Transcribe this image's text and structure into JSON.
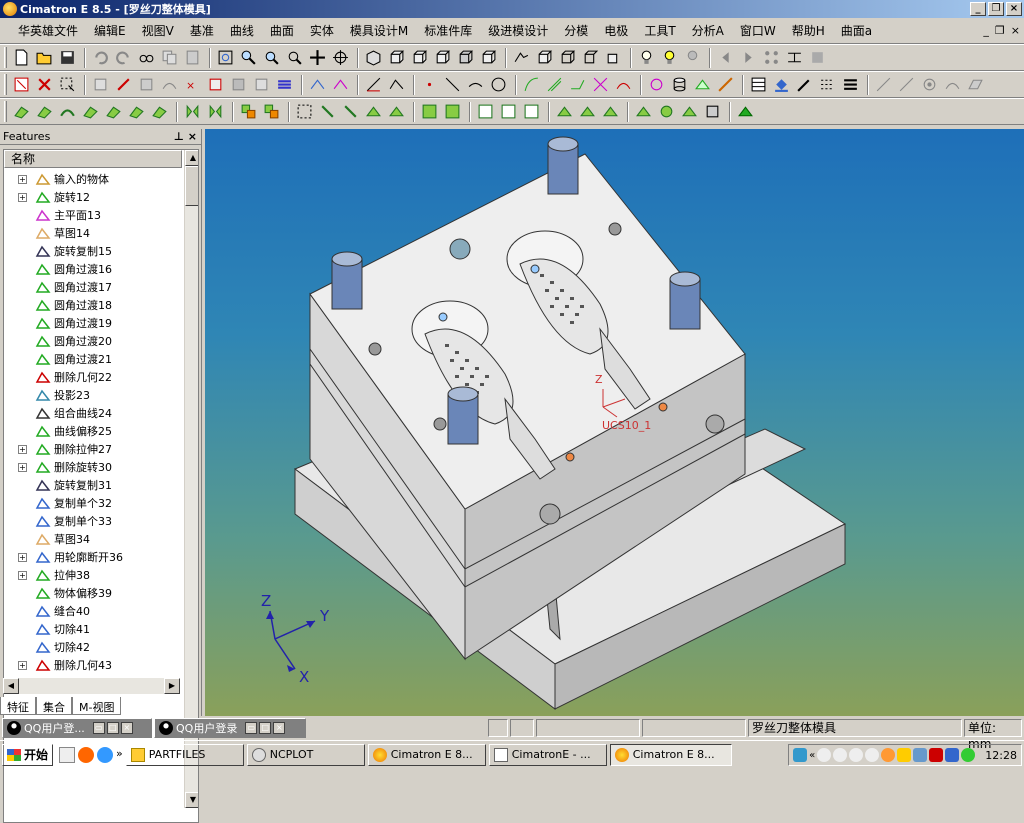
{
  "window": {
    "title": "Cimatron E 8.5 - [罗丝刀整体模具]"
  },
  "menu": {
    "items": [
      "华英雄文件",
      "编辑E",
      "视图V",
      "基准",
      "曲线",
      "曲面",
      "实体",
      "模具设计M",
      "标准件库",
      "级进模设计",
      "分模",
      "电极",
      "工具T",
      "分析A",
      "窗口W",
      "帮助H",
      "曲面a"
    ]
  },
  "features_panel": {
    "title": "Features",
    "column_header": "名称",
    "items": [
      {
        "label": "输入的物体",
        "expandable": true,
        "icon": "import-icon"
      },
      {
        "label": "旋转12",
        "expandable": true,
        "icon": "revolve-icon"
      },
      {
        "label": "主平面13",
        "expandable": false,
        "icon": "plane-icon"
      },
      {
        "label": "草图14",
        "expandable": false,
        "icon": "sketch-icon"
      },
      {
        "label": "旋转复制15",
        "expandable": false,
        "icon": "copy-rotate-icon"
      },
      {
        "label": "圆角过渡16",
        "expandable": false,
        "icon": "fillet-icon"
      },
      {
        "label": "圆角过渡17",
        "expandable": false,
        "icon": "fillet-icon"
      },
      {
        "label": "圆角过渡18",
        "expandable": false,
        "icon": "fillet-icon"
      },
      {
        "label": "圆角过渡19",
        "expandable": false,
        "icon": "fillet-icon"
      },
      {
        "label": "圆角过渡20",
        "expandable": false,
        "icon": "fillet-icon"
      },
      {
        "label": "圆角过渡21",
        "expandable": false,
        "icon": "fillet-icon"
      },
      {
        "label": "删除几何22",
        "expandable": false,
        "icon": "delete-geometry-icon"
      },
      {
        "label": "投影23",
        "expandable": false,
        "icon": "project-icon"
      },
      {
        "label": "组合曲线24",
        "expandable": false,
        "icon": "composite-curve-icon"
      },
      {
        "label": "曲线偏移25",
        "expandable": false,
        "icon": "offset-curve-icon"
      },
      {
        "label": "删除拉伸27",
        "expandable": true,
        "icon": "delete-extrude-icon"
      },
      {
        "label": "删除旋转30",
        "expandable": true,
        "icon": "delete-revolve-icon"
      },
      {
        "label": "旋转复制31",
        "expandable": false,
        "icon": "copy-rotate-icon"
      },
      {
        "label": "复制单个32",
        "expandable": false,
        "icon": "copy-single-icon"
      },
      {
        "label": "复制单个33",
        "expandable": false,
        "icon": "copy-single-icon"
      },
      {
        "label": "草图34",
        "expandable": false,
        "icon": "sketch-icon"
      },
      {
        "label": "用轮廓断开36",
        "expandable": true,
        "icon": "split-icon"
      },
      {
        "label": "拉伸38",
        "expandable": true,
        "icon": "extrude-icon"
      },
      {
        "label": "物体偏移39",
        "expandable": false,
        "icon": "offset-body-icon"
      },
      {
        "label": "缝合40",
        "expandable": false,
        "icon": "stitch-icon"
      },
      {
        "label": "切除41",
        "expandable": false,
        "icon": "cut-icon"
      },
      {
        "label": "切除42",
        "expandable": false,
        "icon": "cut-icon"
      },
      {
        "label": "删除几何43",
        "expandable": true,
        "icon": "delete-geometry-icon"
      }
    ],
    "tabs": [
      "特征",
      "集合",
      "M-视图"
    ],
    "active_tab": 0
  },
  "viewport": {
    "ucs_label": "UCS10_1",
    "ucs_axis": "Z",
    "triad": {
      "x": "X",
      "y": "Y",
      "z": "Z"
    }
  },
  "status": {
    "qq1": "QQ用户登...",
    "qq2": "QQ用户登录",
    "model_name": "罗丝刀整体模具",
    "units": "单位: mm"
  },
  "taskbar": {
    "start": "开始",
    "tasks": [
      {
        "label": "PARTFILES",
        "icon": "folder-icon",
        "active": false
      },
      {
        "label": "NCPLOT",
        "icon": "ncplot-icon",
        "active": false
      },
      {
        "label": "Cimatron E 8...",
        "icon": "cimatron-icon",
        "active": false
      },
      {
        "label": "CimatronE - ...",
        "icon": "document-icon",
        "active": false
      },
      {
        "label": "Cimatron E 8...",
        "icon": "cimatron-icon",
        "active": true
      }
    ],
    "clock": "12:28"
  },
  "colors": {
    "title_start": "#0a246a",
    "title_end": "#a6caf0",
    "viewport_top": "#1e6fb8",
    "viewport_bottom": "#8aa05a"
  }
}
